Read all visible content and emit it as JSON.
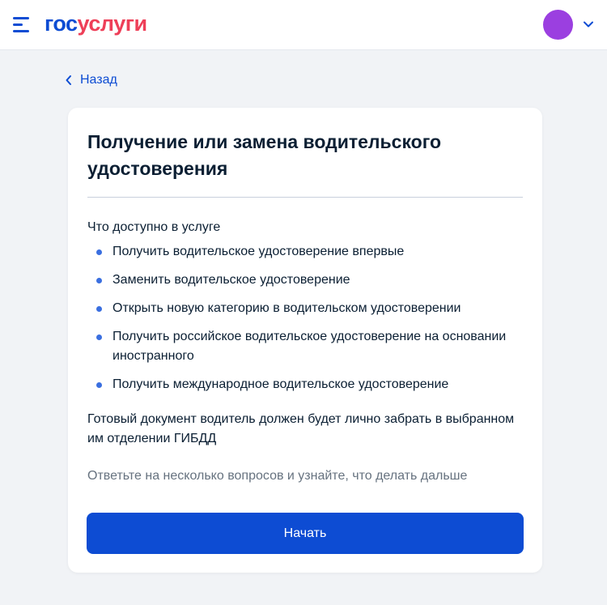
{
  "header": {
    "logo_part1": "гос",
    "logo_part2": "услуги",
    "menu_icon": "burger-menu-icon",
    "profile_chevron_icon": "chevron-down-icon"
  },
  "nav": {
    "back_label": "Назад",
    "back_icon": "chevron-left-icon"
  },
  "card": {
    "title": "Получение или замена водительского удостоверения",
    "subtitle": "Что доступно в услуге",
    "items": [
      "Получить водительское удостоверение впервые",
      "Заменить водительское удостоверение",
      "Открыть новую категорию в водительском удостоверении",
      "Получить российское водительское удостоверение на основании иностранного",
      "Получить международное водительское удостоверение"
    ],
    "note": "Готовый документ водитель должен будет лично забрать в выбранном им отделении ГИБДД",
    "hint": "Ответьте на несколько вопросов и узнайте, что делать дальше",
    "start_button": "Начать"
  },
  "colors": {
    "brand_blue": "#0d4cd3",
    "brand_red": "#ee3f58",
    "avatar": "#9b3fe0",
    "page_background": "#f1f3f6"
  }
}
